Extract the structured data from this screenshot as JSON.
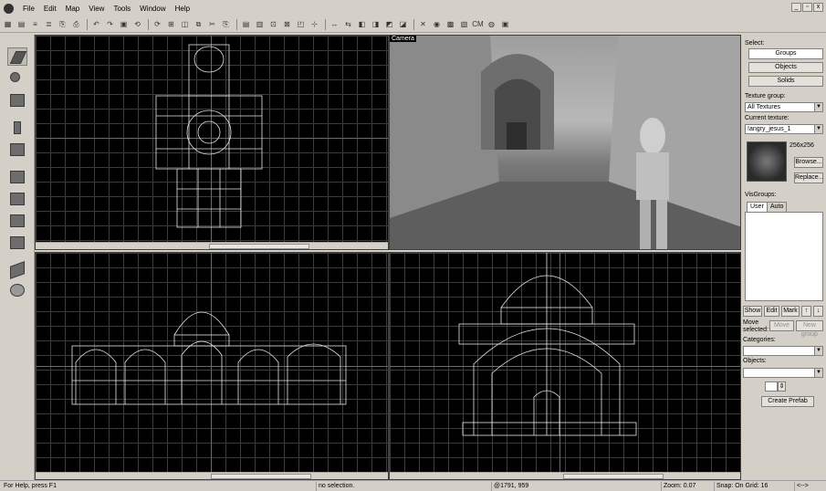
{
  "menubar": {
    "items": [
      "File",
      "Edit",
      "Map",
      "View",
      "Tools",
      "Window",
      "Help"
    ],
    "window_controls": [
      "_",
      "▫",
      "x"
    ]
  },
  "toolbar": {
    "buttons": [
      "▦",
      "▤",
      "≡",
      "≣",
      "⎘",
      "⎙",
      "↶",
      "↷",
      "▣",
      "⟲",
      "⟳",
      "⊞",
      "◫",
      "⧉",
      "✂",
      "⎘",
      "▤",
      "▥",
      "⊡",
      "⊠",
      "◰",
      "⊹",
      "↔",
      "⇆",
      "◧",
      "◨",
      "◩",
      "◪",
      "✕",
      "◉",
      "▩",
      "▧",
      "CM",
      "◍",
      "▣"
    ]
  },
  "viewports": {
    "camera_label": "Camera"
  },
  "right_panel": {
    "select_label": "Select:",
    "groups_button": "Groups",
    "objects_button": "Objects",
    "solids_button": "Solids",
    "texture_group_label": "Texture group:",
    "texture_group_value": "All Textures",
    "current_texture_label": "Current texture:",
    "current_texture_value": "!angry_jesus_1",
    "texture_size": "256x256",
    "browse_button": "Browse...",
    "replace_button": "Replace...",
    "visgroups_label": "VisGroups:",
    "tab_user": "User",
    "tab_auto": "Auto",
    "show_button": "Show",
    "edit_button": "Edit",
    "mark_button": "Mark",
    "move_selected_label": "Move selected:",
    "move_button": "Move",
    "new_group_button": "New group",
    "categories_label": "Categories:",
    "objects_label": "Objects:",
    "create_prefab_button": "Create Prefab"
  },
  "status": {
    "help_text": "For Help, press F1",
    "selection": "no selection.",
    "coords": "@1791, 959",
    "zoom": "Zoom: 0.07",
    "snap": "Snap: On Grid: 16",
    "extra": "<-->"
  }
}
